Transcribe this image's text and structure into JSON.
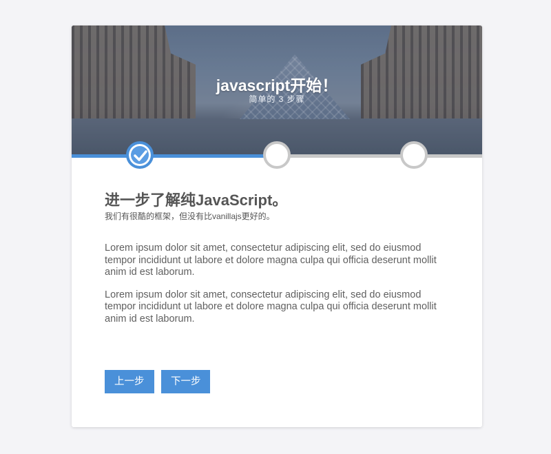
{
  "colors": {
    "page_background": "#f4f4f7",
    "accent": "#4a90d9",
    "inactive_step": "#c8c8c8",
    "text": "#555555"
  },
  "header": {
    "title": "javascript开始！",
    "subtitle": "简单的 3 步骤"
  },
  "steps": [
    {
      "state": "completed",
      "icon": "checkmark-icon"
    },
    {
      "state": "pending"
    },
    {
      "state": "pending"
    }
  ],
  "progress": {
    "fraction": 0.5
  },
  "main": {
    "heading": "进一步了解纯JavaScript。",
    "subheading": "我们有很酷的框架，但没有比vanillajs更好的。",
    "paragraphs": [
      "Lorem ipsum dolor sit amet, consectetur adipiscing elit, sed do eiusmod tempor incididunt ut labore et dolore magna culpa qui officia deserunt mollit anim id est laborum.",
      "Lorem ipsum dolor sit amet, consectetur adipiscing elit, sed do eiusmod tempor incididunt ut labore et dolore magna culpa qui officia deserunt mollit anim id est laborum."
    ]
  },
  "buttons": {
    "prev_label": "上一步",
    "next_label": "下一步"
  }
}
